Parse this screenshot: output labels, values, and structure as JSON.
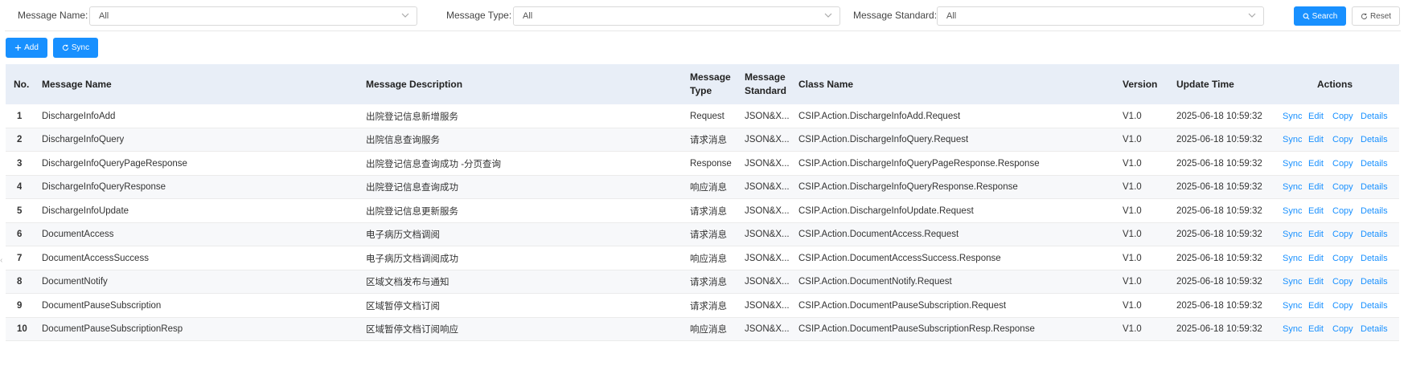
{
  "filters": {
    "message_name": {
      "label": "Message Name:",
      "value": "All"
    },
    "message_type": {
      "label": "Message Type:",
      "value": "All"
    },
    "message_standard": {
      "label": "Message Standard:",
      "value": "All"
    },
    "search_label": "Search",
    "reset_label": "Reset"
  },
  "toolbar": {
    "add_label": "Add",
    "sync_label": "Sync"
  },
  "table": {
    "headers": {
      "no": "No.",
      "name": "Message Name",
      "desc": "Message Description",
      "type_line1": "Message",
      "type_line2": "Type",
      "std_line1": "Message",
      "std_line2": "Standard",
      "class": "Class Name",
      "version": "Version",
      "time": "Update Time",
      "actions": "Actions"
    },
    "actions": {
      "sync": "Sync",
      "edit": "Edit",
      "copy": "Copy",
      "details": "Details"
    },
    "rows": [
      {
        "no": "1",
        "name": "DischargeInfoAdd",
        "desc": "出院登记信息新增服务",
        "type": "Request",
        "std": "JSON&X...",
        "class": "CSIP.Action.DischargeInfoAdd.Request",
        "version": "V1.0",
        "time": "2025-06-18 10:59:32"
      },
      {
        "no": "2",
        "name": "DischargeInfoQuery",
        "desc": "出院信息查询服务",
        "type": "请求消息",
        "std": "JSON&X...",
        "class": "CSIP.Action.DischargeInfoQuery.Request",
        "version": "V1.0",
        "time": "2025-06-18 10:59:32"
      },
      {
        "no": "3",
        "name": "DischargeInfoQueryPageResponse",
        "desc": "出院登记信息查询成功 -分页查询",
        "type": "Response",
        "std": "JSON&X...",
        "class": "CSIP.Action.DischargeInfoQueryPageResponse.Response",
        "version": "V1.0",
        "time": "2025-06-18 10:59:32"
      },
      {
        "no": "4",
        "name": "DischargeInfoQueryResponse",
        "desc": "出院登记信息查询成功",
        "type": "响应消息",
        "std": "JSON&X...",
        "class": "CSIP.Action.DischargeInfoQueryResponse.Response",
        "version": "V1.0",
        "time": "2025-06-18 10:59:32"
      },
      {
        "no": "5",
        "name": "DischargeInfoUpdate",
        "desc": "出院登记信息更新服务",
        "type": "请求消息",
        "std": "JSON&X...",
        "class": "CSIP.Action.DischargeInfoUpdate.Request",
        "version": "V1.0",
        "time": "2025-06-18 10:59:32"
      },
      {
        "no": "6",
        "name": "DocumentAccess",
        "desc": "电子病历文档调阅",
        "type": "请求消息",
        "std": "JSON&X...",
        "class": "CSIP.Action.DocumentAccess.Request",
        "version": "V1.0",
        "time": "2025-06-18 10:59:32"
      },
      {
        "no": "7",
        "name": "DocumentAccessSuccess",
        "desc": "电子病历文档调阅成功",
        "type": "响应消息",
        "std": "JSON&X...",
        "class": "CSIP.Action.DocumentAccessSuccess.Response",
        "version": "V1.0",
        "time": "2025-06-18 10:59:32"
      },
      {
        "no": "8",
        "name": "DocumentNotify",
        "desc": "区域文档发布与通知",
        "type": "请求消息",
        "std": "JSON&X...",
        "class": "CSIP.Action.DocumentNotify.Request",
        "version": "V1.0",
        "time": "2025-06-18 10:59:32"
      },
      {
        "no": "9",
        "name": "DocumentPauseSubscription",
        "desc": "区域暂停文档订阅",
        "type": "请求消息",
        "std": "JSON&X...",
        "class": "CSIP.Action.DocumentPauseSubscription.Request",
        "version": "V1.0",
        "time": "2025-06-18 10:59:32"
      },
      {
        "no": "10",
        "name": "DocumentPauseSubscriptionResp",
        "desc": "区域暂停文档订阅响应",
        "type": "响应消息",
        "std": "JSON&X...",
        "class": "CSIP.Action.DocumentPauseSubscriptionResp.Response",
        "version": "V1.0",
        "time": "2025-06-18 10:59:32"
      }
    ]
  },
  "colors": {
    "primary": "#1890ff",
    "header_bg": "#e8eef7",
    "alt_row": "#f7f8fa"
  },
  "icons": {
    "add": "plus-icon",
    "sync": "refresh-icon",
    "search": "search-icon",
    "reset": "refresh-icon",
    "select": "chevron-down-icon",
    "collapse": "chevron-left-icon"
  }
}
